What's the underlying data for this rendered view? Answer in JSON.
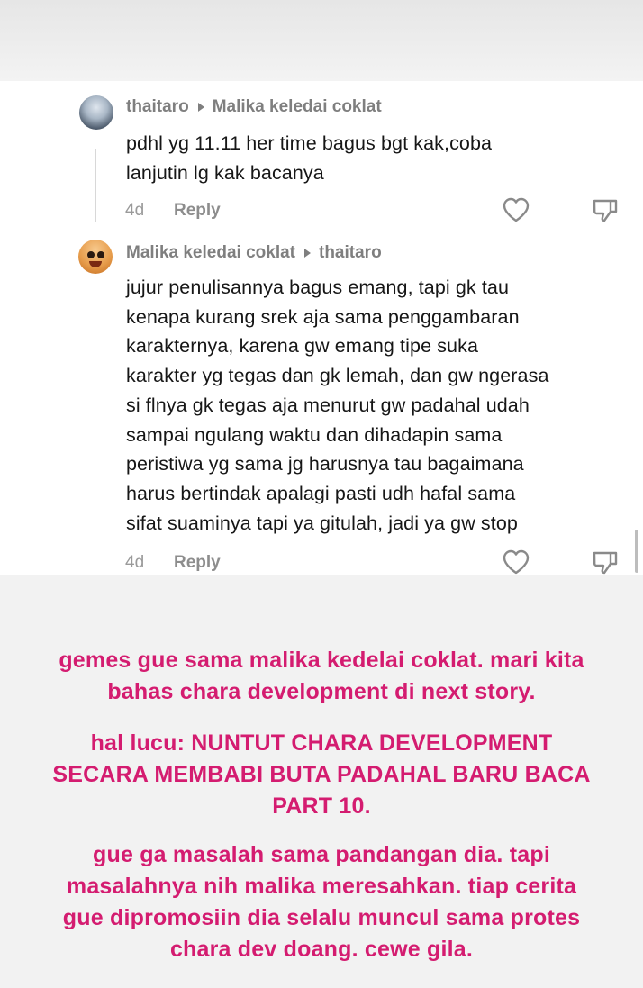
{
  "comments": [
    {
      "author": "thaitaro",
      "reply_to": "Malika keledai coklat",
      "lines": [
        "pdhl yg 11.11 her time bagus bgt kak,coba",
        "lanjutin lg kak bacanya"
      ],
      "age": "4d",
      "reply_label": "Reply"
    },
    {
      "author": "Malika keledai coklat",
      "reply_to": "thaitaro",
      "lines": [
        "jujur penulisannya bagus emang, tapi gk tau",
        "kenapa kurang srek aja sama penggambaran",
        "karakternya, karena gw emang tipe suka",
        "karakter yg tegas dan gk lemah, dan gw ngerasa",
        "si flnya gk tegas aja menurut gw padahal udah",
        "sampai ngulang waktu dan dihadapin sama",
        "peristiwa yg sama jg harusnya tau bagaimana",
        "harus bertindak apalagi pasti udh hafal sama",
        "sifat suaminya tapi ya gitulah, jadi ya gw stop"
      ],
      "age": "4d",
      "reply_label": "Reply"
    }
  ],
  "caption": {
    "paragraph1": [
      "gemes gue sama malika kedelai coklat. mari kita",
      "bahas chara development di next story."
    ],
    "paragraph2": [
      "hal lucu: NUNTUT CHARA DEVELOPMENT",
      "SECARA MEMBABI BUTA PADAHAL BARU BACA",
      "PART 10."
    ],
    "paragraph3": [
      "gue ga masalah sama pandangan dia. tapi",
      "masalahnya nih malika meresahkan. tiap cerita",
      "gue dipromosiin dia selalu muncul sama protes",
      "chara dev doang. cewe gila."
    ]
  },
  "colors": {
    "caption": "#d41c70",
    "background": "#f2f2f2",
    "comment_text": "#161616",
    "meta_text": "#7f7f7f"
  },
  "icons": {
    "like": "heart-icon",
    "dislike": "thumbs-down-icon",
    "reply_arrow": "caret-right-icon"
  }
}
